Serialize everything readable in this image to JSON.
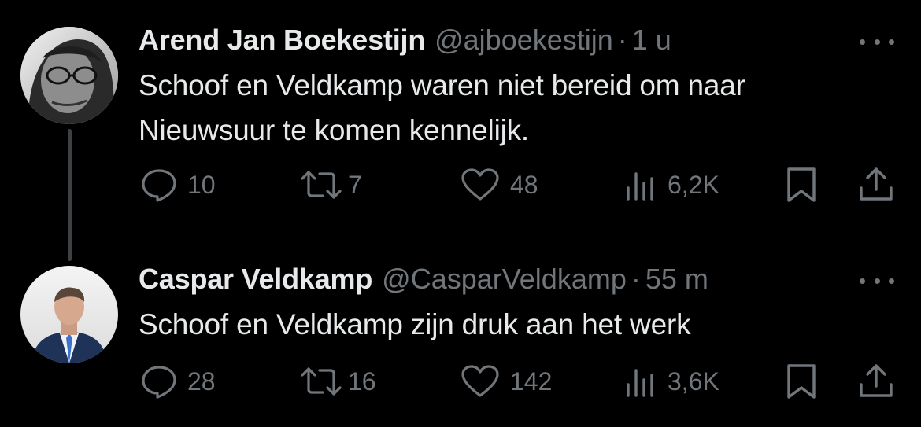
{
  "tweets": [
    {
      "author_name": "Arend Jan Boekestijn",
      "handle": "@ajboekestijn",
      "separator": "·",
      "time": "1 u",
      "text_lines": [
        "Schoof en Veldkamp waren niet bereid om naar",
        "Nieuwsuur te komen kennelijk."
      ],
      "stats": {
        "replies": "10",
        "reposts": "7",
        "likes": "48",
        "views": "6,2K"
      }
    },
    {
      "author_name": "Caspar Veldkamp",
      "handle": "@CasparVeldkamp",
      "separator": "·",
      "time": "55 m",
      "text_lines": [
        "Schoof en Veldkamp zijn druk aan het werk"
      ],
      "stats": {
        "replies": "28",
        "reposts": "16",
        "likes": "142",
        "views": "3,6K"
      }
    }
  ],
  "icons": {
    "reply": "speech-bubble-icon",
    "repost": "repost-arrows-icon",
    "like": "heart-icon",
    "views": "bar-chart-icon",
    "bookmark": "bookmark-icon",
    "share": "share-upload-icon",
    "more": "ellipsis-icon"
  },
  "colors": {
    "background": "#000000",
    "primary_text": "#e7e9ea",
    "secondary_text": "#71767b",
    "thread_line": "#3e4144"
  }
}
